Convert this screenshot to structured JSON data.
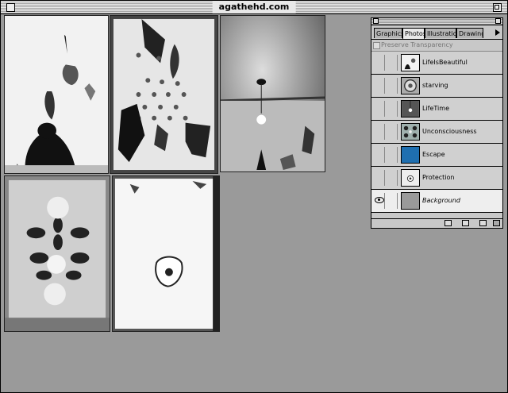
{
  "window": {
    "title": "agathehd.com"
  },
  "palette": {
    "tabs": [
      {
        "label": "Graphics"
      },
      {
        "label": "Photos"
      },
      {
        "label": "Illustrations"
      },
      {
        "label": "Drawings"
      }
    ],
    "active_tab": "Photos",
    "preserve_transparency_label": "Preserve Transparency",
    "layers": [
      {
        "name": "LifeIsBeautiful",
        "visible": false,
        "thumb": "flowers"
      },
      {
        "name": "starving",
        "visible": false,
        "thumb": "plate"
      },
      {
        "name": "LifeTime",
        "visible": false,
        "thumb": "bulb"
      },
      {
        "name": "Unconsciousness",
        "visible": false,
        "thumb": "pattern"
      },
      {
        "name": "Escape",
        "visible": false,
        "thumb": "blue"
      },
      {
        "name": "Protection",
        "visible": false,
        "thumb": "flower"
      },
      {
        "name": "Background",
        "visible": true,
        "thumb": "gray"
      }
    ]
  },
  "icons": {
    "window_close": "close-box-icon",
    "window_zoom": "zoom-box-icon",
    "palette_menu": "triangle-right-icon",
    "layer_visibility": "eye-icon",
    "new_mask": "mask-icon",
    "new_layer": "new-layer-icon",
    "delete_layer": "trash-icon"
  },
  "colors": {
    "desktop": "#9a9a9a",
    "escape_thumb": "#1f6fb0",
    "background_thumb": "#9a9a9a"
  }
}
